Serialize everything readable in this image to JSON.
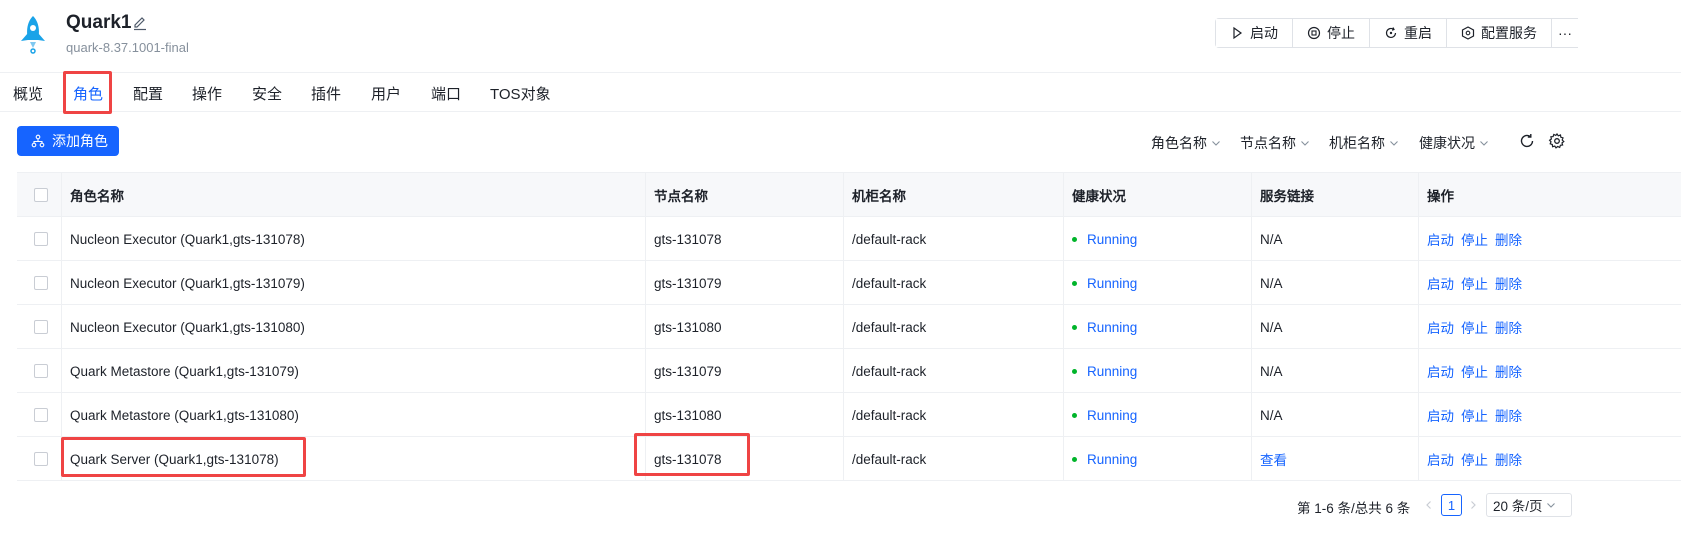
{
  "header": {
    "title": "Quark1",
    "subtitle": "quark-8.37.1001-final",
    "actions": [
      {
        "label": "启动",
        "icon": "play-icon"
      },
      {
        "label": "停止",
        "icon": "stop-circle-icon"
      },
      {
        "label": "重启",
        "icon": "restart-icon"
      },
      {
        "label": "配置服务",
        "icon": "config-service-icon"
      }
    ],
    "more": "···"
  },
  "tabs": [
    {
      "label": "概览"
    },
    {
      "label": "角色",
      "active": true
    },
    {
      "label": "配置"
    },
    {
      "label": "操作"
    },
    {
      "label": "安全"
    },
    {
      "label": "插件"
    },
    {
      "label": "用户"
    },
    {
      "label": "端口"
    },
    {
      "label": "TOS对象"
    }
  ],
  "toolbar": {
    "add_label": "添加角色",
    "filters": [
      "角色名称",
      "节点名称",
      "机柜名称",
      "健康状况"
    ]
  },
  "table": {
    "columns": [
      "角色名称",
      "节点名称",
      "机柜名称",
      "健康状况",
      "服务链接",
      "操作"
    ],
    "rows": [
      {
        "role": "Nucleon Executor (Quark1,gts-131078)",
        "node": "gts-131078",
        "rack": "/default-rack",
        "health": "Running",
        "link": "N/A",
        "actions": [
          "启动",
          "停止",
          "删除"
        ]
      },
      {
        "role": "Nucleon Executor (Quark1,gts-131079)",
        "node": "gts-131079",
        "rack": "/default-rack",
        "health": "Running",
        "link": "N/A",
        "actions": [
          "启动",
          "停止",
          "删除"
        ]
      },
      {
        "role": "Nucleon Executor (Quark1,gts-131080)",
        "node": "gts-131080",
        "rack": "/default-rack",
        "health": "Running",
        "link": "N/A",
        "actions": [
          "启动",
          "停止",
          "删除"
        ]
      },
      {
        "role": "Quark Metastore (Quark1,gts-131079)",
        "node": "gts-131079",
        "rack": "/default-rack",
        "health": "Running",
        "link": "N/A",
        "actions": [
          "启动",
          "停止",
          "删除"
        ]
      },
      {
        "role": "Quark Metastore (Quark1,gts-131080)",
        "node": "gts-131080",
        "rack": "/default-rack",
        "health": "Running",
        "link": "N/A",
        "actions": [
          "启动",
          "停止",
          "删除"
        ]
      },
      {
        "role": "Quark Server (Quark1,gts-131078)",
        "node": "gts-131078",
        "rack": "/default-rack",
        "health": "Running",
        "link": "查看",
        "actions": [
          "启动",
          "停止",
          "删除"
        ]
      }
    ]
  },
  "pagination": {
    "summary": "第 1-6 条/总共 6 条",
    "current_page": "1",
    "page_size": "20 条/页"
  },
  "colors": {
    "primary": "#1664ff",
    "running": "#00b42a",
    "annotation": "#ef4444"
  }
}
